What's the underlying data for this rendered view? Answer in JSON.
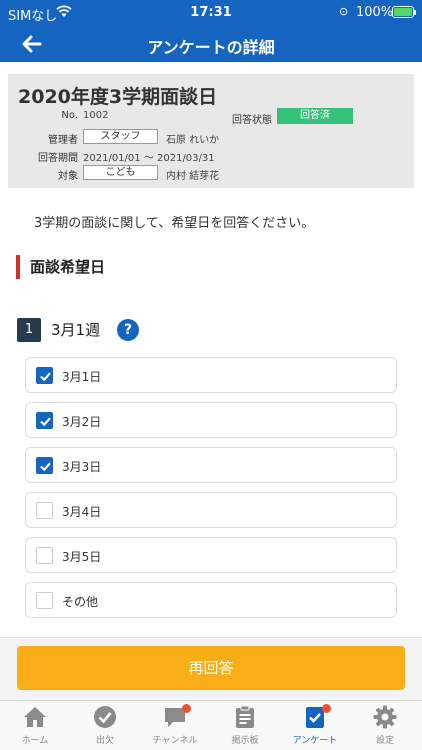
{
  "status_bar": {
    "carrier": "SIMなし",
    "time": "17:31",
    "battery": "100%"
  },
  "header": {
    "title": "アンケートの詳細"
  },
  "info": {
    "title": "2020年度3学期面談日",
    "no_label": "No.",
    "no_value": "1002",
    "status_label": "回答状態",
    "status_value": "回答済",
    "manager_label": "管理者",
    "manager_role": "スタッフ",
    "manager_name": "石原 れいか",
    "period_label": "回答期間",
    "period_value": "2021/01/01 ～ 2021/03/31",
    "target_label": "対象",
    "target_role": "こども",
    "target_name": "内村 結芽花"
  },
  "description": "3学期の面談に関して、希望日を回答ください。",
  "section": {
    "heading": "面談希望日"
  },
  "question": {
    "number": "1",
    "title": "3月1週",
    "help": "?",
    "options": [
      {
        "label": "3月1日",
        "checked": true
      },
      {
        "label": "3月2日",
        "checked": true
      },
      {
        "label": "3月3日",
        "checked": true
      },
      {
        "label": "3月4日",
        "checked": false
      },
      {
        "label": "3月5日",
        "checked": false
      },
      {
        "label": "その他",
        "checked": false
      }
    ]
  },
  "actions": {
    "reanswer_label": "再回答"
  },
  "tabs": [
    {
      "label": "ホーム",
      "icon": "home-icon"
    },
    {
      "label": "出欠",
      "icon": "check-circle-icon"
    },
    {
      "label": "チャンネル",
      "icon": "chat-icon",
      "badge": true
    },
    {
      "label": "掲示板",
      "icon": "clipboard-icon"
    },
    {
      "label": "アンケート",
      "icon": "survey-icon",
      "badge": true,
      "active": true
    },
    {
      "label": "設定",
      "icon": "gear-icon"
    }
  ],
  "colors": {
    "primary": "#1565c0",
    "accent": "#f9ad16",
    "status_green": "#34c27a",
    "section_red": "#d32f2f"
  }
}
